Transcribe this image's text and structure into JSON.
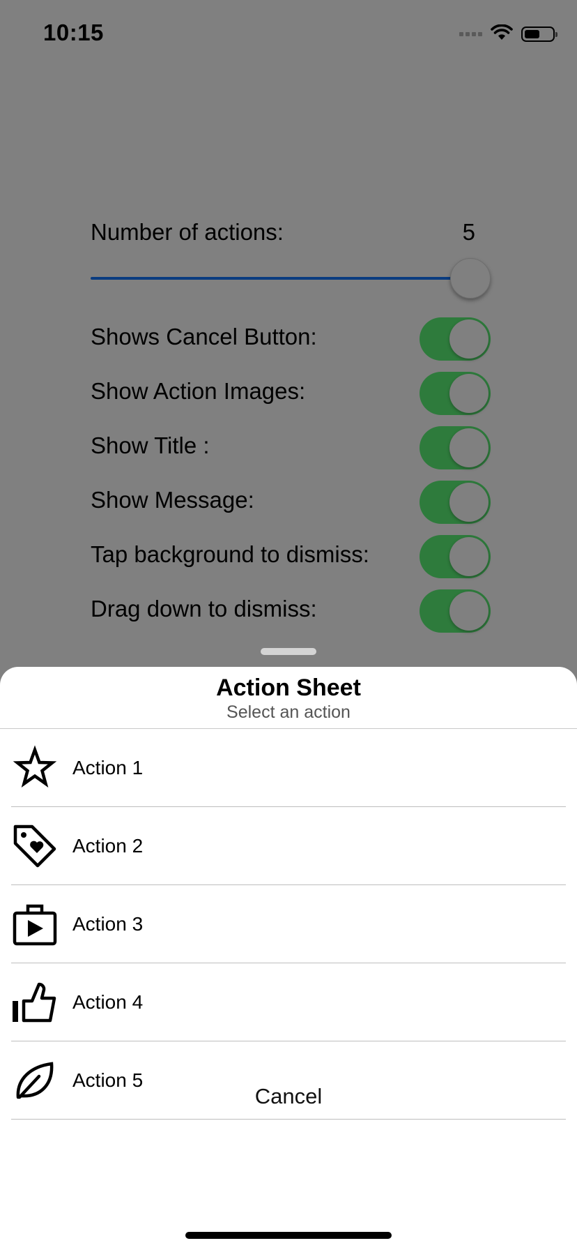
{
  "status_bar": {
    "time": "10:15"
  },
  "settings": {
    "count_label": "Number of actions:",
    "count_value": "5",
    "slider": {
      "min": 1,
      "max": 5,
      "value": 5
    },
    "toggles": [
      {
        "label": "Shows Cancel Button:",
        "on": true
      },
      {
        "label": "Show Action Images:",
        "on": true
      },
      {
        "label": "Show Title :",
        "on": true
      },
      {
        "label": "Show Message:",
        "on": true
      },
      {
        "label": "Tap background to dismiss:",
        "on": true
      },
      {
        "label": "Drag down to dismiss:",
        "on": true
      }
    ]
  },
  "sheet": {
    "title": "Action Sheet",
    "message": "Select an action",
    "actions": [
      {
        "label": "Action 1",
        "icon": "star-icon"
      },
      {
        "label": "Action 2",
        "icon": "heart-tag-icon"
      },
      {
        "label": "Action 3",
        "icon": "play-bag-icon"
      },
      {
        "label": "Action 4",
        "icon": "thumbs-up-icon"
      },
      {
        "label": "Action 5",
        "icon": "leaf-icon"
      }
    ],
    "cancel_label": "Cancel"
  },
  "colors": {
    "overlay": "#808080",
    "toggle_on": "#2e7b3c",
    "slider_track": "#0a3c80",
    "sheet_background": "#ffffff"
  }
}
